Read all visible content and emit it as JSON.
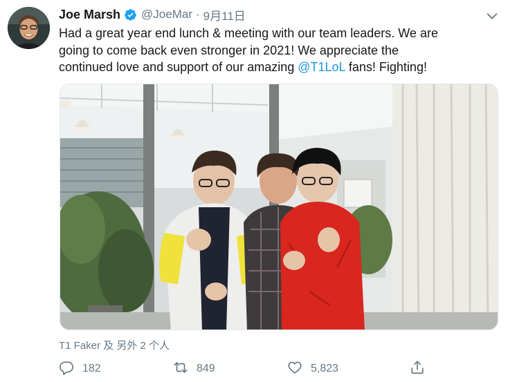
{
  "author": {
    "display_name": "Joe Marsh",
    "handle": "@JoeMar",
    "separator": "·",
    "date": "9月11日",
    "verified": true
  },
  "tweet": {
    "lines": [
      "Had a great year end lunch & meeting with our team leaders. We are",
      "going to come back even stronger in 2021! We appreciate the"
    ],
    "line3_prefix": "continued love and support of our amazing ",
    "mention": "@T1LoL",
    "line3_suffix": " fans! Fighting!"
  },
  "tagged": {
    "text": "T1 Faker 及 另外 2 个人"
  },
  "actions": {
    "reply_count": "182",
    "retweet_count": "849",
    "like_count": "5,823"
  },
  "icons": {
    "verified": "verified-badge-icon",
    "caret": "chevron-down-icon",
    "reply": "reply-icon",
    "retweet": "retweet-icon",
    "like": "heart-icon",
    "share": "share-icon"
  },
  "colors": {
    "text": "#14171a",
    "secondary": "#657786",
    "link": "#1b95e0",
    "verified": "#1da1f2"
  }
}
